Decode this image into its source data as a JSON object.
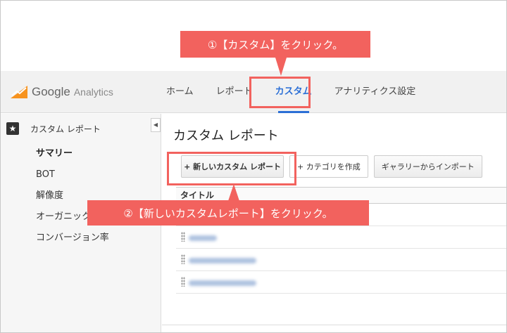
{
  "header": {
    "logo_google": "Google",
    "logo_analytics": "Analytics",
    "nav": [
      {
        "label": "ホーム",
        "active": false
      },
      {
        "label": "レポート",
        "active": false
      },
      {
        "label": "カスタム",
        "active": true
      },
      {
        "label": "アナリティクス設定",
        "active": false
      }
    ]
  },
  "sidebar": {
    "title": "カスタム レポート",
    "items": [
      {
        "label": "サマリー",
        "selected": true
      },
      {
        "label": "BOT",
        "selected": false
      },
      {
        "label": "解像度",
        "selected": false
      },
      {
        "label": "オーガニック検",
        "selected": false
      },
      {
        "label": "コンバージョン率",
        "selected": false
      }
    ]
  },
  "main": {
    "title": "カスタム レポート",
    "buttons": {
      "new_report": "+ 新しいカスタム レポート",
      "category": "+ カテゴリを作成",
      "import": "ギャラリーからインポート"
    },
    "table": {
      "header": "タイトル"
    }
  },
  "annotations": {
    "step1": "①【カスタム】をクリック。",
    "step2": "②【新しいカスタムレポート】をクリック。"
  },
  "colors": {
    "accent": "#2b6fd6",
    "annotation": "#f2625e"
  }
}
